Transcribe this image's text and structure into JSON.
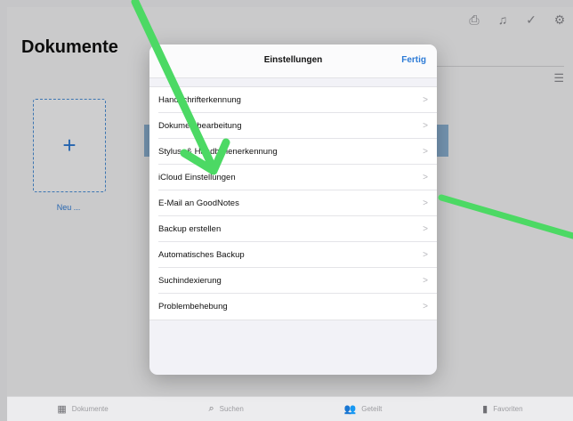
{
  "header": {
    "title": "Dokumente",
    "icons": [
      "document-lock-icon",
      "bell-icon",
      "checkmark-circle-icon",
      "gear-icon"
    ]
  },
  "library": {
    "new_label": "Neu ...",
    "new_icon": "plus-icon"
  },
  "modal": {
    "title": "Einstellungen",
    "done_label": "Fertig",
    "items": [
      {
        "label": "Handschrifterkennung"
      },
      {
        "label": "Dokumentbearbeitung"
      },
      {
        "label": "Stylus- & Handballenerkennung"
      },
      {
        "label": "iCloud Einstellungen"
      },
      {
        "label": "E-Mail an GoodNotes"
      },
      {
        "label": "Backup erstellen"
      },
      {
        "label": "Automatisches Backup"
      },
      {
        "label": "Suchindexierung"
      },
      {
        "label": "Problembehebung"
      }
    ]
  },
  "tabs": [
    {
      "label": "Dokumente",
      "icon": "grid-icon"
    },
    {
      "label": "Suchen",
      "icon": "search-icon"
    },
    {
      "label": "Geteilt",
      "icon": "people-icon"
    },
    {
      "label": "Favoriten",
      "icon": "bookmark-icon"
    }
  ],
  "colors": {
    "accent": "#2d7bd6",
    "annotation": "#4cd964"
  }
}
